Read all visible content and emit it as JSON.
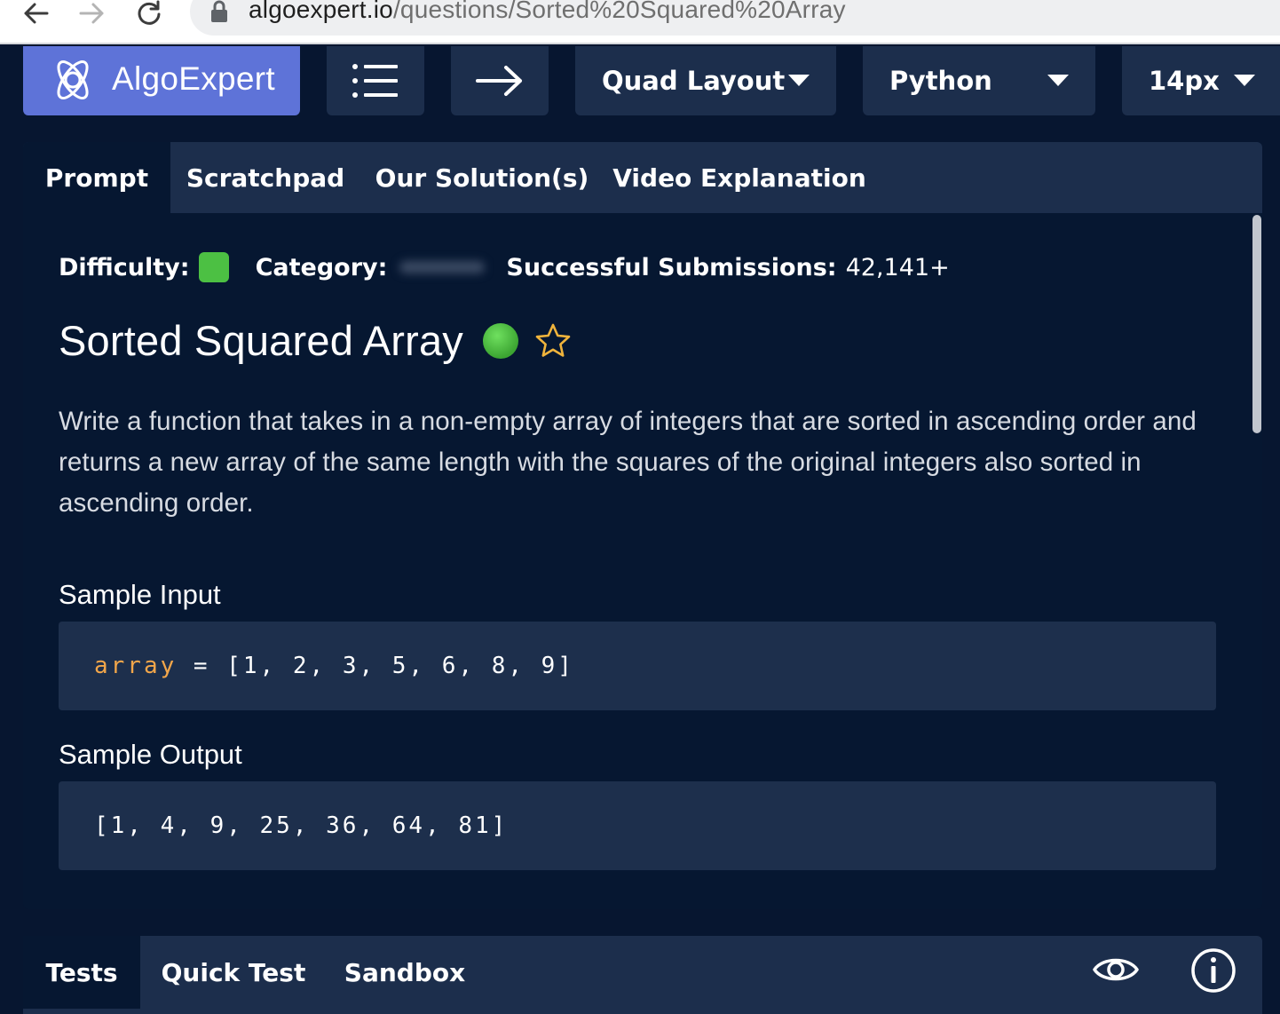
{
  "browser": {
    "url_host": "algoexpert.io",
    "url_path": "/questions/Sorted%20Squared%20Array"
  },
  "toolbar": {
    "logo_text": "AlgoExpert",
    "layout_select": "Quad Layout",
    "language_select": "Python",
    "font_size_select": "14px"
  },
  "tabs": [
    {
      "label": "Prompt",
      "active": true
    },
    {
      "label": "Scratchpad",
      "active": false
    },
    {
      "label": "Our Solution(s)",
      "active": false
    },
    {
      "label": "Video Explanation",
      "active": false
    }
  ],
  "meta": {
    "difficulty_label": "Difficulty:",
    "difficulty_color": "#4cc043",
    "category_label": "Category:",
    "submissions_label": "Successful Submissions:",
    "submissions_value": "42,141+"
  },
  "question": {
    "title": "Sorted Squared Array",
    "status_color": "#4cc043",
    "description": "Write a function that takes in a non-empty array of integers that are sorted in ascending order and returns a new array of the same length with the squares of the original integers also sorted in ascending order."
  },
  "sample_input": {
    "label": "Sample Input",
    "variable": "array",
    "rest": " = [1, 2, 3, 5, 6, 8, 9]"
  },
  "sample_output": {
    "label": "Sample Output",
    "value": "[1, 4, 9, 25, 36, 64, 81]"
  },
  "bottom_tabs": [
    {
      "label": "Tests",
      "active": true
    },
    {
      "label": "Quick Test",
      "active": false
    },
    {
      "label": "Sandbox",
      "active": false
    }
  ],
  "icons": [
    "back-arrow-icon",
    "forward-arrow-icon",
    "reload-icon",
    "lock-icon",
    "atom-logo-icon",
    "list-icon",
    "right-arrow-icon",
    "caret-down-icon",
    "star-icon",
    "eye-icon",
    "info-icon"
  ]
}
